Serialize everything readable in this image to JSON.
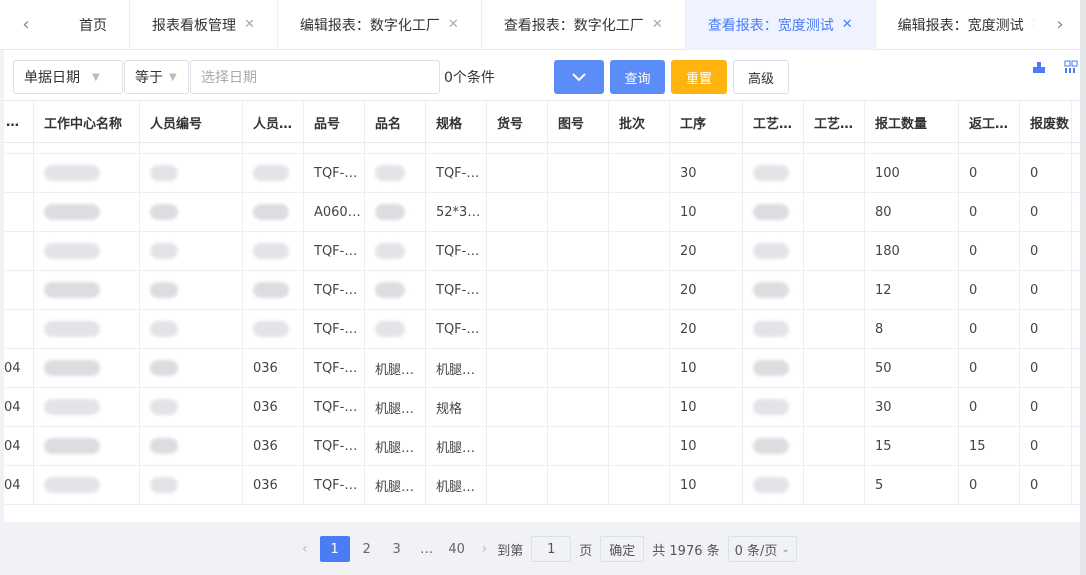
{
  "tabs": {
    "prev_icon": "‹",
    "next_icon": "›",
    "items": [
      {
        "label": "首页",
        "closable": false,
        "active": false
      },
      {
        "label": "报表看板管理",
        "closable": true,
        "active": false
      },
      {
        "label": "编辑报表：数字化工厂",
        "closable": true,
        "active": false
      },
      {
        "label": "查看报表：数字化工厂",
        "closable": true,
        "active": false
      },
      {
        "label": "查看报表：宽度测试",
        "closable": true,
        "active": true
      },
      {
        "label": "编辑报表：宽度测试",
        "closable": true,
        "active": false
      }
    ],
    "close_glyph": "✕"
  },
  "filter": {
    "field_select": "单据日期",
    "operator_select": "等于",
    "date_placeholder": "选择日期",
    "condition_count": "0个条件",
    "expand_icon": "chevron-down-icon",
    "query_label": "查询",
    "reset_label": "重置",
    "advanced_label": "高级"
  },
  "toolbar_icons": [
    "export-icon",
    "layout-grid-icon"
  ],
  "table": {
    "columns": [
      "…",
      "工作中心名称",
      "人员编号",
      "人员…",
      "品号",
      "品名",
      "规格",
      "货号",
      "图号",
      "批次",
      "工序",
      "工艺…",
      "工艺…",
      "报工数量",
      "返工…",
      "报废数"
    ],
    "rows": [
      {
        "c0": "",
        "c3": "",
        "c4": "TQF-…",
        "c5": "",
        "c6": "TQF-…",
        "c10": "30",
        "c13": "100",
        "c14": "0",
        "c15": "0"
      },
      {
        "c0": "",
        "c3": "",
        "c4": "A060…",
        "c5": "",
        "c6": "52*3…",
        "c10": "10",
        "c13": "80",
        "c14": "0",
        "c15": "0"
      },
      {
        "c0": "",
        "c3": "",
        "c4": "TQF-…",
        "c5": "",
        "c6": "TQF-…",
        "c10": "20",
        "c13": "180",
        "c14": "0",
        "c15": "0"
      },
      {
        "c0": "",
        "c3": "",
        "c4": "TQF-…",
        "c5": "",
        "c6": "TQF-…",
        "c10": "20",
        "c13": "12",
        "c14": "0",
        "c15": "0"
      },
      {
        "c0": "",
        "c3": "",
        "c4": "TQF-…",
        "c5": "",
        "c6": "TQF-…",
        "c10": "20",
        "c13": "8",
        "c14": "0",
        "c15": "0"
      },
      {
        "c0": "04",
        "c3": "036",
        "c4": "TQF-…",
        "c5": "机腿…",
        "c6": "机腿…",
        "c10": "10",
        "c13": "50",
        "c14": "0",
        "c15": "0"
      },
      {
        "c0": "04",
        "c3": "036",
        "c4": "TQF-…",
        "c5": "机腿…",
        "c6": "规格",
        "c10": "10",
        "c13": "30",
        "c14": "0",
        "c15": "0"
      },
      {
        "c0": "04",
        "c3": "036",
        "c4": "TQF-…",
        "c5": "机腿…",
        "c6": "机腿…",
        "c10": "10",
        "c13": "15",
        "c14": "15",
        "c15": "0"
      },
      {
        "c0": "04",
        "c3": "036",
        "c4": "TQF-…",
        "c5": "机腿…",
        "c6": "机腿…",
        "c10": "10",
        "c13": "5",
        "c14": "0",
        "c15": "0"
      }
    ]
  },
  "pagination": {
    "pages": [
      "1",
      "2",
      "3",
      "…",
      "40"
    ],
    "current": "1",
    "goto_label": "到第",
    "goto_value": "1",
    "page_suffix": "页",
    "confirm_label": "确定",
    "total_label": "共 1976 条",
    "page_size": "0 条/页"
  }
}
